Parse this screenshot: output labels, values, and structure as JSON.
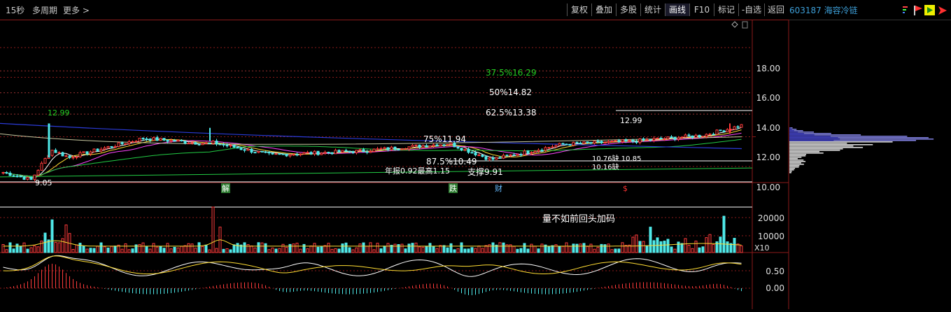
{
  "toolbar": {
    "left": [
      "15秒",
      "多周期",
      "更多 >"
    ],
    "buttons": [
      "复权",
      "叠加",
      "多股",
      "统计",
      "画线",
      "F10",
      "标记",
      "-自选",
      "返回"
    ],
    "active_button": "画线",
    "stock": "603187 海容冷链"
  },
  "price_axis": [
    "18.00",
    "16.00",
    "14.00",
    "12.00",
    "10.00"
  ],
  "fib_levels": [
    {
      "label": "37.5%16.29",
      "price": 16.29,
      "color": "#22cc22"
    },
    {
      "label": "50%14.82",
      "price": 14.82,
      "color": "#ffffff"
    },
    {
      "label": "62.5%13.38",
      "price": 13.38,
      "color": "#ffffff"
    },
    {
      "label": "75%11.94",
      "price": 11.94,
      "color": "#ffffff"
    },
    {
      "label": "87.5%10.49",
      "price": 10.49,
      "color": "#ffffff"
    }
  ],
  "annotations": {
    "high_left": "12.99",
    "high_right": "12.99",
    "low": "9.05",
    "support": "支撑9.91",
    "annual": "年报0.92最高1.15",
    "t1": "10.76缺 10.85",
    "t2": "10.16缺",
    "volume_note": "量不如前回头加码"
  },
  "event_markers": [
    {
      "label": "解",
      "color": "#ffffff",
      "bg": "#2e7d32"
    },
    {
      "label": "跌",
      "color": "#ffffff",
      "bg": "#2e7d32"
    },
    {
      "label": "财",
      "color": "#66bbff",
      "bg": "none"
    },
    {
      "label": "$",
      "color": "#ff3333",
      "bg": "none"
    }
  ],
  "volume_axis": [
    "20000",
    "10000"
  ],
  "volume_unit": "X10",
  "indicator_axis": [
    "0.50",
    "0.00"
  ],
  "icons": [
    "sort-icon",
    "flag-icon",
    "play-icon",
    "arrow-icon"
  ]
}
